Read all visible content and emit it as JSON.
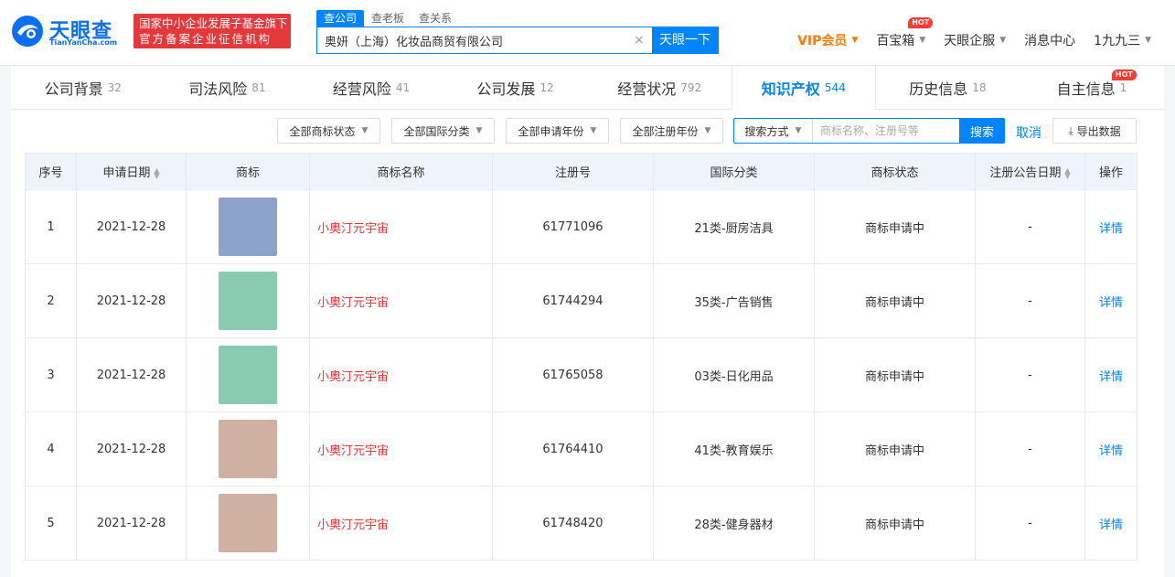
{
  "header": {
    "logo_text": "天眼查",
    "logo_sub": "TianYanCha.com",
    "badge_line1": "国家中小企业发展子基金旗下",
    "badge_line2": "官方备案企业征信机构",
    "search_tabs": [
      {
        "label": "查公司",
        "active": true
      },
      {
        "label": "查老板",
        "active": false
      },
      {
        "label": "查关系",
        "active": false
      }
    ],
    "search_value": "奥妍（上海）化妆品商贸有限公司",
    "search_clear": "×",
    "search_button": "天眼一下",
    "nav": {
      "vip": "VIP会员",
      "baibaoxiang": "百宝箱",
      "baibaoxiang_badge": "HOT",
      "qifu": "天眼企服",
      "messages": "消息中心",
      "user": "1九九三"
    }
  },
  "tabs": [
    {
      "label": "公司背景",
      "count": "32"
    },
    {
      "label": "司法风险",
      "count": "81"
    },
    {
      "label": "经营风险",
      "count": "41"
    },
    {
      "label": "公司发展",
      "count": "12"
    },
    {
      "label": "经营状况",
      "count": "792"
    },
    {
      "label": "知识产权",
      "count": "544",
      "active": true
    },
    {
      "label": "历史信息",
      "count": "18"
    },
    {
      "label": "自主信息",
      "count": "1",
      "badge": "HOT"
    }
  ],
  "filters": {
    "status": "全部商标状态",
    "intl_class": "全部国际分类",
    "apply_year": "全部申请年份",
    "register_year": "全部注册年份",
    "search_mode": "搜索方式",
    "search_placeholder": "商标名称、注册号等",
    "search_button": "搜索",
    "cancel": "取消",
    "export": "导出数据"
  },
  "table": {
    "headers": [
      "序号",
      "申请日期",
      "商标",
      "商标名称",
      "注册号",
      "国际分类",
      "商标状态",
      "注册公告日期",
      "操作"
    ],
    "rows": [
      {
        "index": "1",
        "date": "2021-12-28",
        "color": "#8ea3cc",
        "name": "小奥汀元宇宙",
        "reg_no": "61771096",
        "class": "21类-厨房洁具",
        "status": "商标申请中",
        "notice_date": "-",
        "action": "详情"
      },
      {
        "index": "2",
        "date": "2021-12-28",
        "color": "#88cbb1",
        "name": "小奥汀元宇宙",
        "reg_no": "61744294",
        "class": "35类-广告销售",
        "status": "商标申请中",
        "notice_date": "-",
        "action": "详情"
      },
      {
        "index": "3",
        "date": "2021-12-28",
        "color": "#88cbb1",
        "name": "小奥汀元宇宙",
        "reg_no": "61765058",
        "class": "03类-日化用品",
        "status": "商标申请中",
        "notice_date": "-",
        "action": "详情"
      },
      {
        "index": "4",
        "date": "2021-12-28",
        "color": "#d0b0a0",
        "name": "小奥汀元宇宙",
        "reg_no": "61764410",
        "class": "41类-教育娱乐",
        "status": "商标申请中",
        "notice_date": "-",
        "action": "详情"
      },
      {
        "index": "5",
        "date": "2021-12-28",
        "color": "#d0b0a0",
        "name": "小奥汀元宇宙",
        "reg_no": "61748420",
        "class": "28类-健身器材",
        "status": "商标申请中",
        "notice_date": "-",
        "action": "详情"
      }
    ]
  },
  "colors": {
    "brand_blue": "#0084ff",
    "brand_red": "#e4393c",
    "vip_orange": "#ff7a00",
    "header_bg": "#eef3fc"
  }
}
